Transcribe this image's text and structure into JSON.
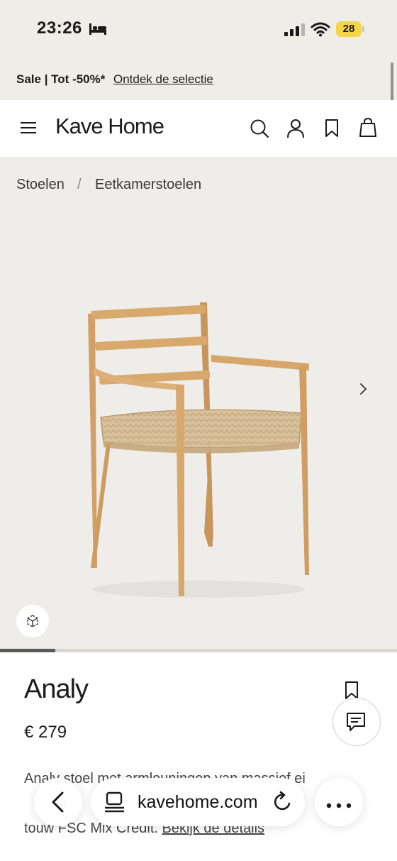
{
  "status_bar": {
    "time": "23:26",
    "battery": "28"
  },
  "promo": {
    "text": "Sale | Tot -50%*",
    "link": "Ontdek de selectie"
  },
  "header": {
    "logo": "Kave Home"
  },
  "breadcrumb": {
    "items": [
      "Stoelen",
      "Eetkamerstoelen"
    ],
    "separator": "/"
  },
  "gallery": {
    "progress": 0.14
  },
  "product": {
    "name": "Analy",
    "price": "€ 279",
    "description": "Analy stoel met armleuningen van massief ei",
    "description_2": "ut",
    "description_3": "tt",
    "description_4": "touw FSC Mix Credit.",
    "details_link": "Bekijk de details"
  },
  "browser": {
    "url": "kavehome.com"
  },
  "colors": {
    "promo_bg": "#eeede6",
    "gallery_bg": "#eeede9",
    "battery": "#f5d54a",
    "text": "#1c1c1c"
  },
  "icons": [
    "bed-icon",
    "signal-icon",
    "wifi-icon",
    "menu-icon",
    "search-icon",
    "account-icon",
    "bookmark-icon",
    "bag-icon",
    "chevron-right-icon",
    "ar-view-icon",
    "chat-icon",
    "back-icon",
    "reader-icon",
    "reload-icon",
    "more-icon"
  ]
}
